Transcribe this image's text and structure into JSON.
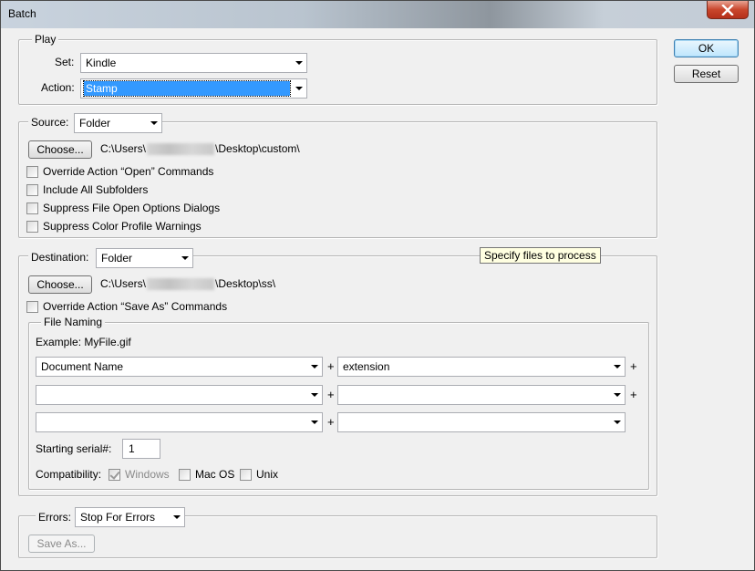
{
  "window": {
    "title": "Batch"
  },
  "buttons": {
    "ok": "OK",
    "reset": "Reset"
  },
  "play": {
    "legend": "Play",
    "set_label": "Set:",
    "set_value": "Kindle",
    "action_label": "Action:",
    "action_value": "Stamp"
  },
  "source": {
    "label": "Source:",
    "value": "Folder",
    "choose": "Choose...",
    "path_prefix": "C:\\Users\\",
    "path_suffix": "\\Desktop\\custom\\",
    "checks": [
      {
        "label": "Override Action “Open” Commands",
        "checked": false
      },
      {
        "label": "Include All Subfolders",
        "checked": false
      },
      {
        "label": "Suppress File Open Options Dialogs",
        "checked": false
      },
      {
        "label": "Suppress Color Profile Warnings",
        "checked": false
      }
    ]
  },
  "destination": {
    "label": "Destination:",
    "value": "Folder",
    "tooltip": "Specify files to process",
    "choose": "Choose...",
    "path_prefix": "C:\\Users\\",
    "path_suffix": "\\Desktop\\ss\\",
    "override_save": "Override Action “Save As” Commands"
  },
  "file_naming": {
    "legend": "File Naming",
    "example": "Example: MyFile.gif",
    "fields": [
      [
        "Document Name",
        "extension"
      ],
      [
        "",
        ""
      ],
      [
        "",
        ""
      ]
    ],
    "plus": "+",
    "serial_label": "Starting serial#:",
    "serial_value": "1",
    "compat_label": "Compatibility:",
    "compat": [
      {
        "label": "Windows",
        "checked": true,
        "disabled": true
      },
      {
        "label": "Mac OS",
        "checked": false,
        "disabled": false
      },
      {
        "label": "Unix",
        "checked": false,
        "disabled": false
      }
    ]
  },
  "errors": {
    "label": "Errors:",
    "value": "Stop For Errors",
    "save_as": "Save As..."
  }
}
